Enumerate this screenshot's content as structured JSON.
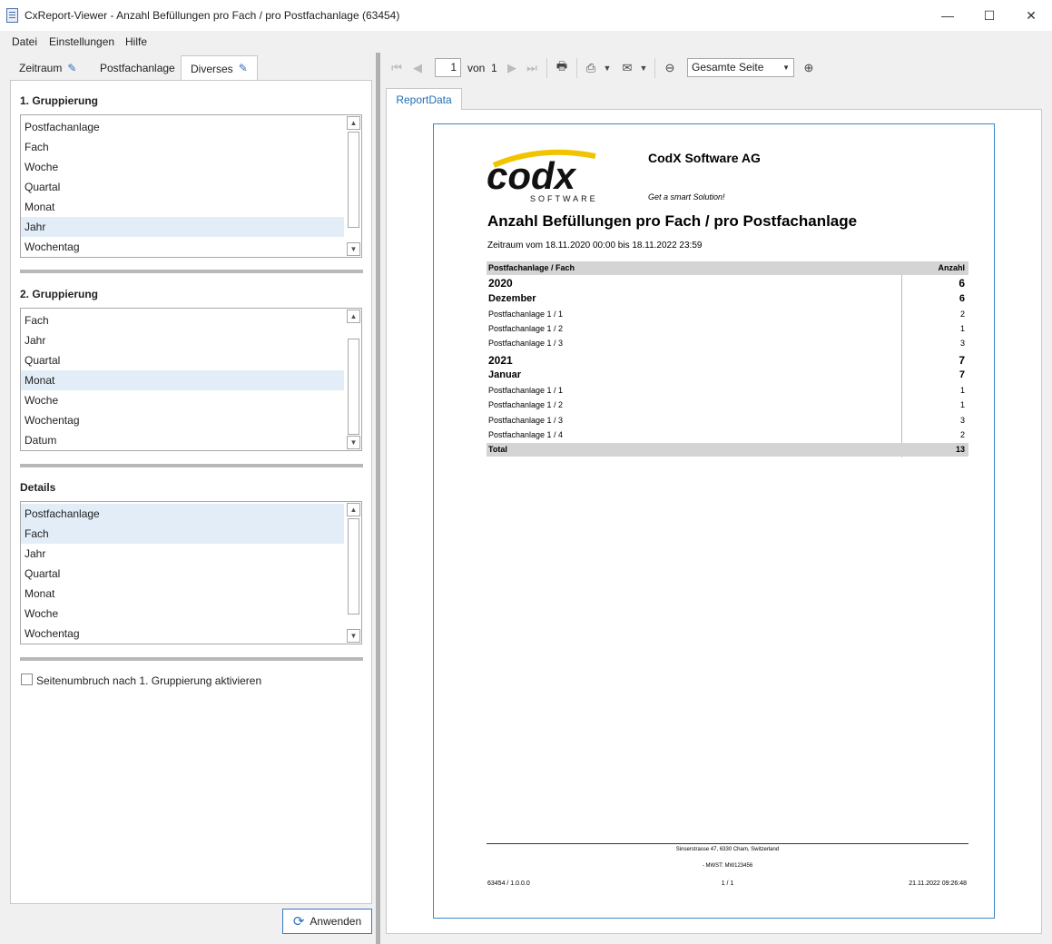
{
  "window": {
    "title": "CxReport-Viewer - Anzahl Befüllungen pro Fach / pro Postfachanlage (63454)",
    "minimize": "—",
    "maximize": "☐",
    "close": "✕"
  },
  "menu": [
    "Datei",
    "Einstellungen",
    "Hilfe"
  ],
  "left_tabs": [
    {
      "label": "Zeitraum",
      "icon": "pencil-icon"
    },
    {
      "label": "Postfachanlage",
      "icon": ""
    },
    {
      "label": "Diverses",
      "icon": "pencil-icon",
      "active": true
    }
  ],
  "group1": {
    "title": "1. Gruppierung",
    "items": [
      "Postfachanlage",
      "Fach",
      "Woche",
      "Quartal",
      "Monat",
      "Jahr",
      "Wochentag"
    ],
    "selected": [
      "Jahr"
    ]
  },
  "group2": {
    "title": "2. Gruppierung",
    "items": [
      "Fach",
      "Jahr",
      "Quartal",
      "Monat",
      "Woche",
      "Wochentag",
      "Datum"
    ],
    "selected": [
      "Monat"
    ]
  },
  "details": {
    "title": "Details",
    "items": [
      "Postfachanlage",
      "Fach",
      "Jahr",
      "Quartal",
      "Monat",
      "Woche",
      "Wochentag"
    ],
    "selected": [
      "Postfachanlage",
      "Fach"
    ]
  },
  "page_break_checkbox": {
    "label": "Seitenumbruch nach 1. Gruppierung aktivieren",
    "checked": false
  },
  "apply_button": "Anwenden",
  "toolbar": {
    "page": "1",
    "of_label": "von",
    "total_pages": "1",
    "zoom": "Gesamte Seite"
  },
  "report_tab": "ReportData",
  "report": {
    "company": "CodX Software AG",
    "logo_text": "codx",
    "logo_sub": "SOFTWARE",
    "slogan": "Get a smart Solution!",
    "title": "Anzahl Befüllungen pro Fach / pro Postfachanlage",
    "period": "Zeitraum vom 18.11.2020 00:00 bis 18.11.2022 23:59",
    "header": {
      "left": "Postfachanlage / Fach",
      "right": "Anzahl"
    },
    "rows": [
      {
        "label": "2020",
        "value": "6",
        "level": "year"
      },
      {
        "label": "Dezember",
        "value": "6",
        "level": "month"
      },
      {
        "label": "Postfachanlage 1 / 1",
        "value": "2",
        "level": "detail"
      },
      {
        "label": "Postfachanlage 1 / 2",
        "value": "1",
        "level": "detail"
      },
      {
        "label": "Postfachanlage 1 / 3",
        "value": "3",
        "level": "detail"
      },
      {
        "label": "2021",
        "value": "7",
        "level": "year"
      },
      {
        "label": "Januar",
        "value": "7",
        "level": "month"
      },
      {
        "label": "Postfachanlage 1 / 1",
        "value": "1",
        "level": "detail"
      },
      {
        "label": "Postfachanlage 1 / 2",
        "value": "1",
        "level": "detail"
      },
      {
        "label": "Postfachanlage 1 / 3",
        "value": "3",
        "level": "detail"
      },
      {
        "label": "Postfachanlage 1 / 4",
        "value": "2",
        "level": "detail"
      }
    ],
    "total": {
      "label": "Total",
      "value": "13"
    },
    "footer": {
      "address": "Sinserstrasse 47, 6330 Cham, Switzerland",
      "vat": "- MWST: MW123456",
      "version": "63454 / 1.0.0.0",
      "page": "1 / 1",
      "timestamp": "21.11.2022 09:26:48"
    }
  },
  "colors": {
    "accent": "#2f6fb8",
    "selection": "#e3edf8",
    "logo_yellow": "#f2c400"
  }
}
